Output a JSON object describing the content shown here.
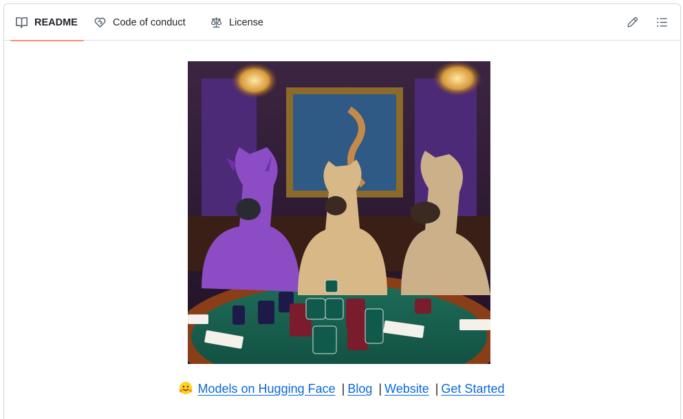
{
  "tabs": [
    {
      "label": "README",
      "icon": "book-icon",
      "active": true
    },
    {
      "label": "Code of conduct",
      "icon": "code-of-conduct-icon",
      "active": false
    },
    {
      "label": "License",
      "icon": "law-icon",
      "active": false
    }
  ],
  "toolbar": {
    "edit_icon": "pencil-icon",
    "outline_icon": "list-unordered-icon"
  },
  "readme": {
    "hero_image": "three llamas playing poker",
    "links": [
      {
        "label": "Models on Hugging Face"
      },
      {
        "label": "Blog"
      },
      {
        "label": "Website"
      },
      {
        "label": "Get Started"
      }
    ],
    "separator": "|",
    "emoji": "hugging-face-icon"
  },
  "colors": {
    "accent_underline": "#fd8c73",
    "link": "#0969da",
    "border": "#d0d7de"
  }
}
